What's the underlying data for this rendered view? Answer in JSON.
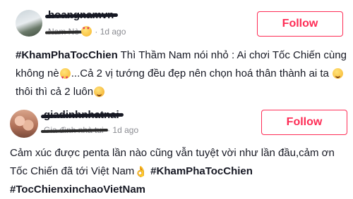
{
  "comments": [
    {
      "username": "hoangnamvn",
      "handle": "Nam Nè",
      "time": "· 1d ago",
      "follow_label": "Follow",
      "hashtag": "#KhamPhaTocChien",
      "text_a": " Thì Thầm Nam nói nhỏ : Ai chơi Tốc Chiến cùng không nè",
      "text_b": "...Cả 2 vị tướng đều đẹp nên chọn hoá thân thành ai ta ",
      "text_c": "thôi thì cả 2 luôn",
      "emojis": [
        "smiling-face-with-hearts-emoji",
        "smiling-face-emoji",
        "rolling-laughing-emoji"
      ]
    },
    {
      "username": "giadinhnhatnai",
      "handle": "Gia đình nhà tui",
      "time": "· 1d ago",
      "follow_label": "Follow",
      "text_a": "Cảm xúc được penta lần nào cũng vẫn tuyệt vời như lần đầu,cảm ơn Tốc Chiến đã tới Việt Nam",
      "hashtag": " #KhamPhaTocChien",
      "hashtag2": "#TocChienxinchaoVietNam",
      "emojis": [
        "ok-hand-emoji"
      ]
    }
  ],
  "colors": {
    "accent": "#fe2c55",
    "text": "#161823",
    "meta": "#8a8b91"
  }
}
